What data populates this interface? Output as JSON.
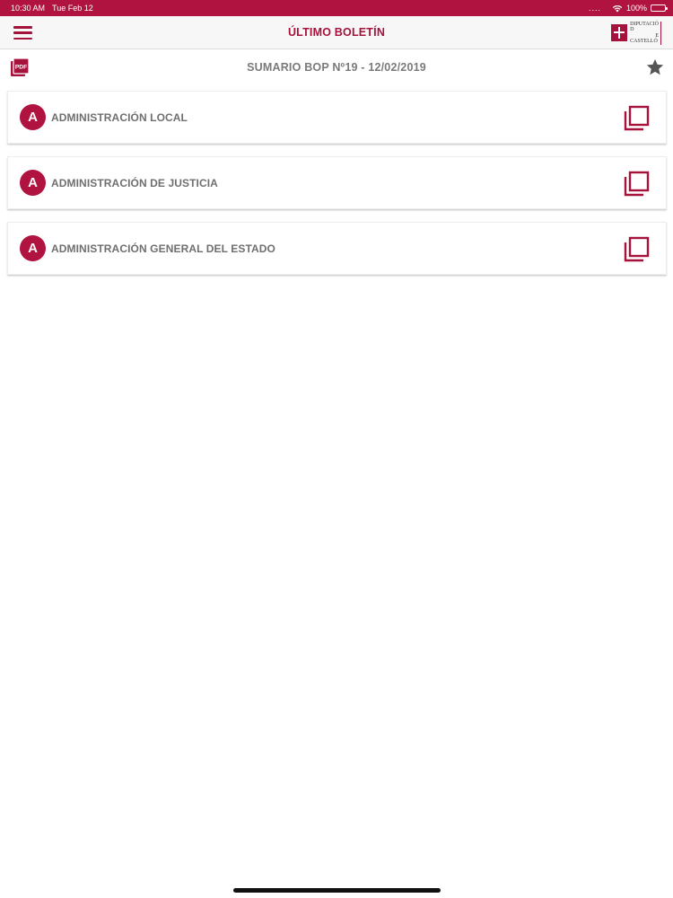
{
  "status_bar": {
    "time": "10:30 AM",
    "date": "Tue Feb 12",
    "dots": "....",
    "wifi_icon": "wifi-icon",
    "battery_percent": "100%",
    "battery_level": 1.0
  },
  "nav": {
    "menu_icon": "hamburger-menu-icon",
    "title": "ÚLTIMO BOLETÍN",
    "logo": {
      "line1": "DIPUTACIÓ",
      "line2": "D",
      "line3": "E",
      "line4": "CASTELLÓ"
    }
  },
  "sub_header": {
    "pdf_icon": "pdf-icon",
    "title": "SUMARIO BOP Nº19 - 12/02/2019",
    "star_icon": "star-icon"
  },
  "sections": [
    {
      "badge": "A",
      "label": "ADMINISTRACIÓN LOCAL",
      "icon": "copy-icon"
    },
    {
      "badge": "A",
      "label": "ADMINISTRACIÓN DE JUSTICIA",
      "icon": "copy-icon"
    },
    {
      "badge": "A",
      "label": "ADMINISTRACIÓN GENERAL DEL ESTADO",
      "icon": "copy-icon"
    }
  ],
  "colors": {
    "brand": "#b0133f",
    "nav_background": "#f7f7f7",
    "label_gray": "#6f6f6f"
  }
}
